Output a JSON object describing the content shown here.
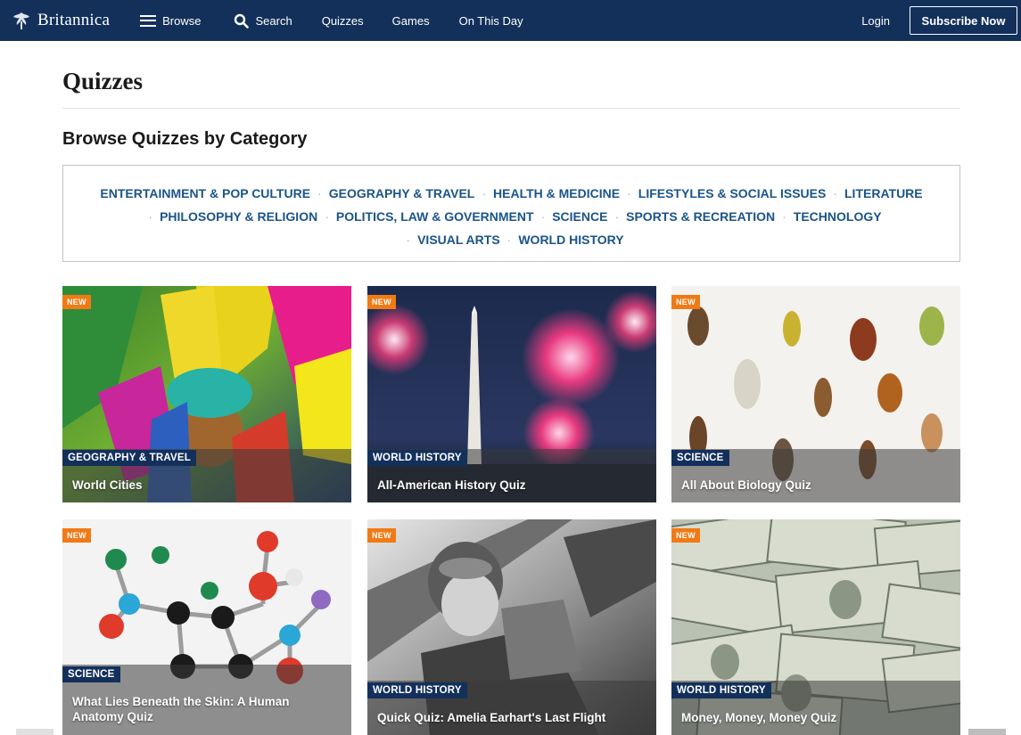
{
  "nav": {
    "logo_text": "Britannica",
    "browse": "Browse",
    "search": "Search",
    "quizzes": "Quizzes",
    "games": "Games",
    "on_this_day": "On This Day",
    "login": "Login",
    "subscribe": "Subscribe Now"
  },
  "page": {
    "title": "Quizzes",
    "section_title": "Browse Quizzes by Category"
  },
  "categories": {
    "line1": [
      "ENTERTAINMENT & POP CULTURE",
      "GEOGRAPHY & TRAVEL",
      "HEALTH & MEDICINE",
      "LIFESTYLES & SOCIAL ISSUES",
      "LITERATURE"
    ],
    "line2": [
      "PHILOSOPHY & RELIGION",
      "POLITICS, LAW & GOVERNMENT",
      "SCIENCE",
      "SPORTS & RECREATION",
      "TECHNOLOGY"
    ],
    "line3": [
      "VISUAL ARTS",
      "WORLD HISTORY"
    ],
    "separator": "·"
  },
  "cards": [
    {
      "badge": "NEW",
      "category": "GEOGRAPHY & TRAVEL",
      "title": "World Cities",
      "image": "carnival-feathers-image"
    },
    {
      "badge": "NEW",
      "category": "WORLD HISTORY",
      "title": "All-American History Quiz",
      "image": "monument-fireworks-image"
    },
    {
      "badge": "NEW",
      "category": "SCIENCE",
      "title": "All About Biology Quiz",
      "image": "insects-image"
    },
    {
      "badge": "NEW",
      "category": "SCIENCE",
      "title": "What Lies Beneath the Skin: A Human Anatomy Quiz",
      "image": "molecule-model-image"
    },
    {
      "badge": "NEW",
      "category": "WORLD HISTORY",
      "title": "Quick Quiz: Amelia Earhart's Last Flight",
      "image": "aviator-photo-image"
    },
    {
      "badge": "NEW",
      "category": "WORLD HISTORY",
      "title": "Money, Money, Money Quiz",
      "image": "dollar-bills-image"
    }
  ],
  "colors": {
    "nav_bg": "#13305b",
    "link_blue": "#1a5489",
    "badge_orange": "#f07a15",
    "category_tag": "#13305b"
  }
}
